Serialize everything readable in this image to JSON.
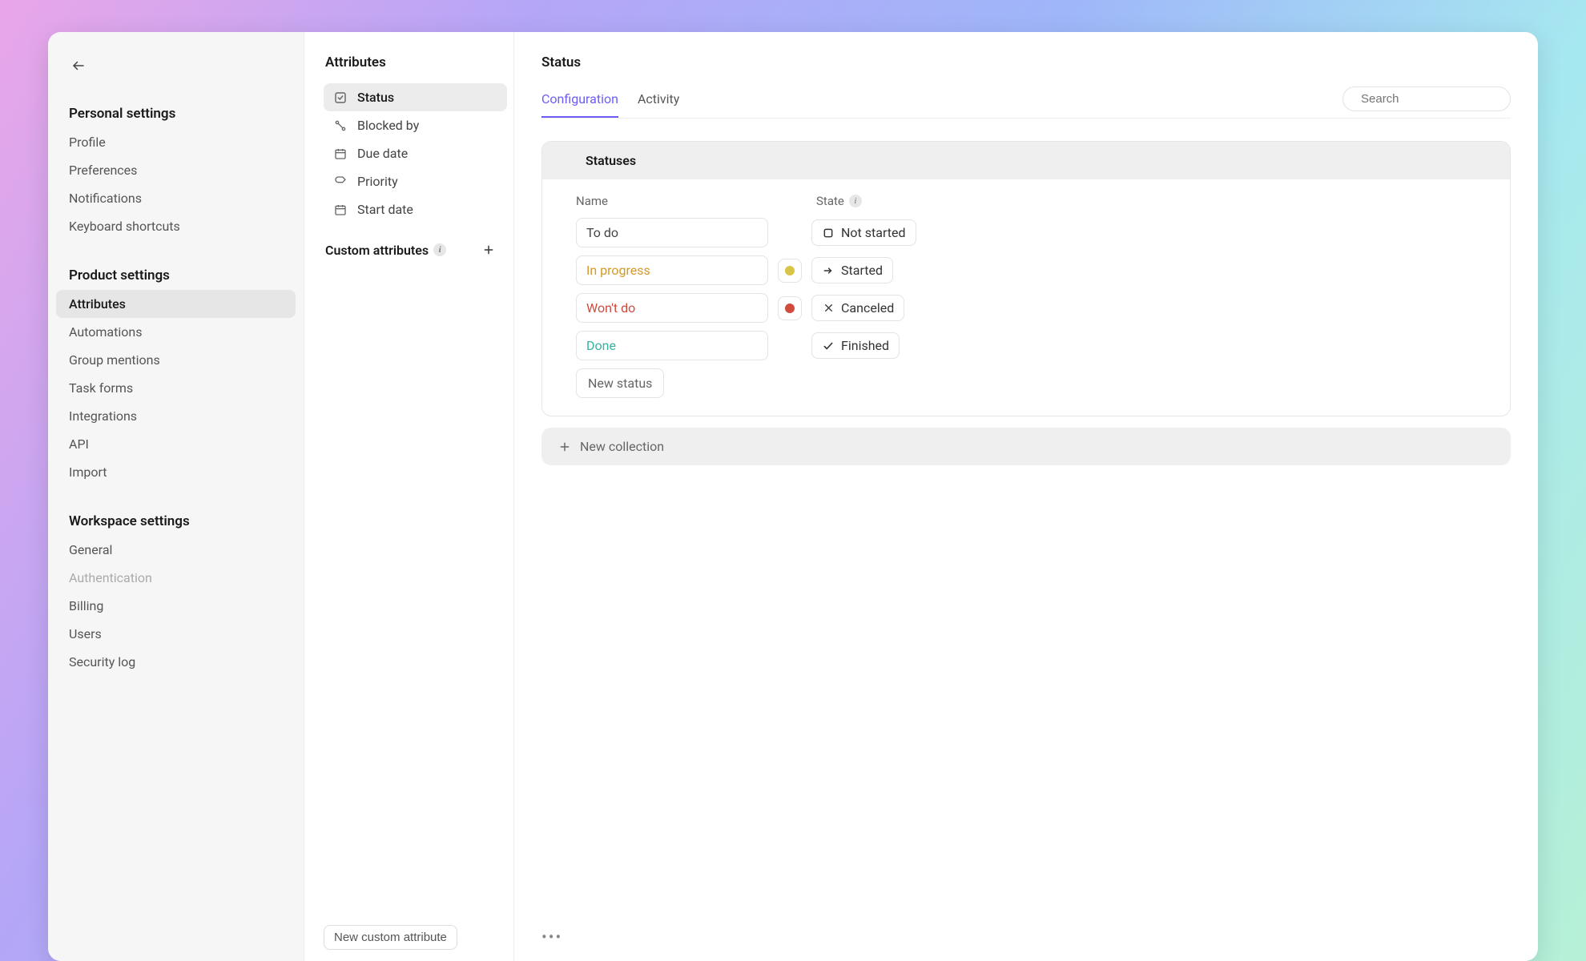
{
  "sidebar": {
    "sections": [
      {
        "title": "Personal settings",
        "items": [
          {
            "label": "Profile"
          },
          {
            "label": "Preferences"
          },
          {
            "label": "Notifications"
          },
          {
            "label": "Keyboard shortcuts"
          }
        ]
      },
      {
        "title": "Product settings",
        "items": [
          {
            "label": "Attributes",
            "active": true
          },
          {
            "label": "Automations"
          },
          {
            "label": "Group mentions"
          },
          {
            "label": "Task forms"
          },
          {
            "label": "Integrations"
          },
          {
            "label": "API"
          },
          {
            "label": "Import"
          }
        ]
      },
      {
        "title": "Workspace settings",
        "items": [
          {
            "label": "General"
          },
          {
            "label": "Authentication",
            "muted": true
          },
          {
            "label": "Billing"
          },
          {
            "label": "Users"
          },
          {
            "label": "Security log"
          }
        ]
      }
    ]
  },
  "attributes_panel": {
    "heading": "Attributes",
    "items": [
      {
        "label": "Status",
        "icon": "checkbox-icon",
        "active": true
      },
      {
        "label": "Blocked by",
        "icon": "relation-icon"
      },
      {
        "label": "Due date",
        "icon": "calendar-icon"
      },
      {
        "label": "Priority",
        "icon": "tag-icon"
      },
      {
        "label": "Start date",
        "icon": "calendar-icon"
      }
    ],
    "custom_heading": "Custom attributes",
    "new_custom_label": "New custom attribute"
  },
  "main": {
    "title": "Status",
    "tabs": [
      {
        "label": "Configuration",
        "active": true
      },
      {
        "label": "Activity"
      }
    ],
    "search_placeholder": "Search",
    "card_heading": "Statuses",
    "column_headers": {
      "name": "Name",
      "state": "State"
    },
    "statuses": [
      {
        "name": "To do",
        "name_color": "#444444",
        "swatch": null,
        "state_icon": "square-icon",
        "state_label": "Not started"
      },
      {
        "name": "In progress",
        "name_color": "#d39a2a",
        "swatch": "#d8c447",
        "state_icon": "arrow-right-icon",
        "state_label": "Started"
      },
      {
        "name": "Won't do",
        "name_color": "#d04a3e",
        "swatch": "#d04a3e",
        "state_icon": "x-icon",
        "state_label": "Canceled"
      },
      {
        "name": "Done",
        "name_color": "#38b2a0",
        "swatch": null,
        "state_icon": "check-icon",
        "state_label": "Finished"
      }
    ],
    "new_status_label": "New status",
    "new_collection_label": "New collection"
  }
}
